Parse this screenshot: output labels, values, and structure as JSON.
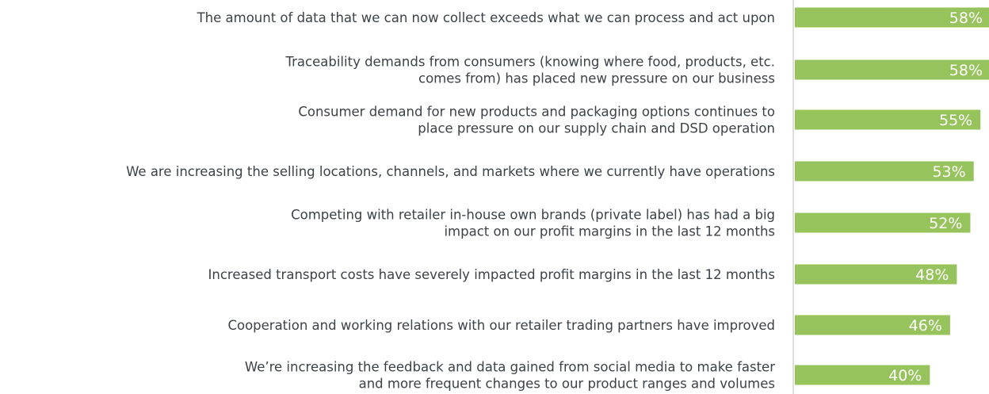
{
  "colors": {
    "bar": "#97c35c",
    "label_text": "#3c4248",
    "value_text": "#ffffff",
    "axis_line": "#c8c8c8"
  },
  "chart_data": {
    "type": "bar",
    "orientation": "horizontal",
    "categories": [
      [
        "The amount of data that we can now collect exceeds what we can process and act upon"
      ],
      [
        "Traceability demands from consumers (knowing where food, products, etc.",
        "comes from) has placed new pressure on our business"
      ],
      [
        "Consumer demand for new products and packaging options continues to",
        "place pressure on our supply chain and DSD operation"
      ],
      [
        "We are increasing the selling locations, channels, and markets where we currently have operations"
      ],
      [
        "Competing with retailer in-house own brands (private label) has had a big",
        "impact on our profit margins in the last 12 months"
      ],
      [
        "Increased transport costs have severely impacted profit margins in the last 12 months"
      ],
      [
        "Cooperation and working relations with our retailer trading partners have improved"
      ],
      [
        "We’re increasing the feedback and data gained from social media to make faster",
        "and more frequent changes to our product ranges and volumes"
      ]
    ],
    "values": [
      58,
      58,
      55,
      53,
      52,
      48,
      46,
      40
    ],
    "value_labels": [
      "58%",
      "58%",
      "55%",
      "53%",
      "52%",
      "48%",
      "46%",
      "40%"
    ],
    "unit": "%",
    "xlim": [
      0,
      58
    ],
    "grid": false,
    "legend": "none"
  }
}
